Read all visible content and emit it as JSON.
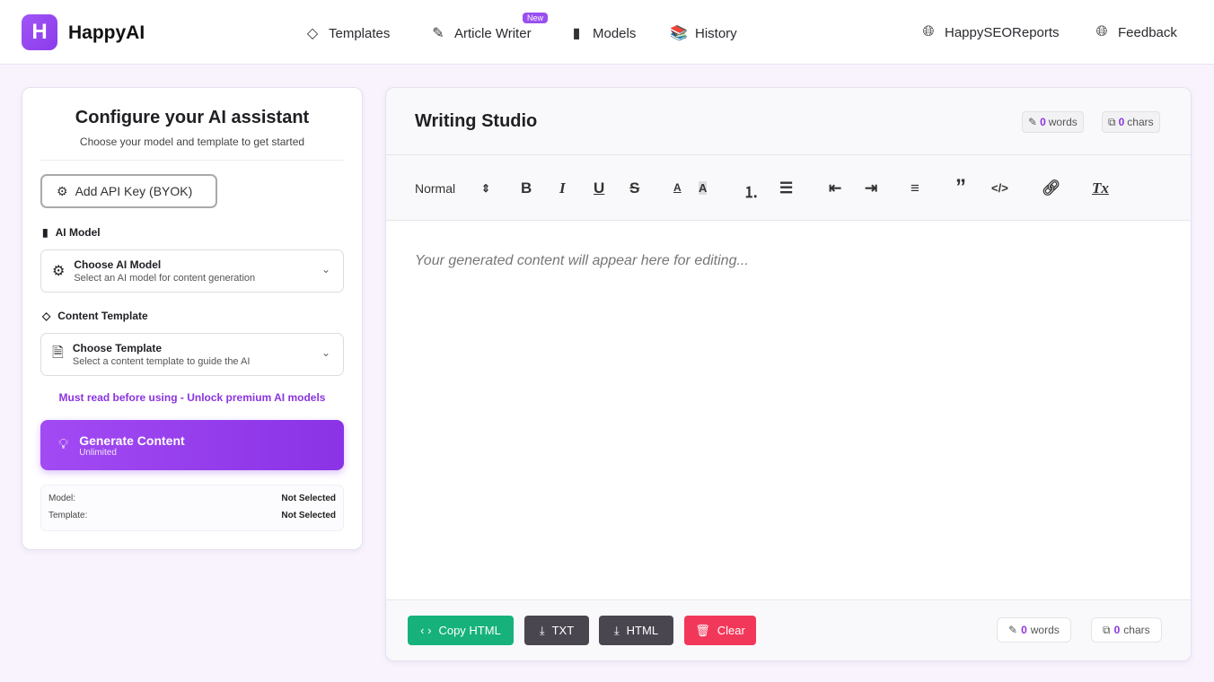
{
  "header": {
    "logo_letter": "H",
    "brand": "HappyAI",
    "nav": [
      {
        "label": "Templates",
        "icon": "tag-icon"
      },
      {
        "label": "Article Writer",
        "icon": "memo-icon",
        "badge": "New"
      },
      {
        "label": "Models",
        "icon": "ruler-icon"
      },
      {
        "label": "History",
        "icon": "books-icon"
      }
    ],
    "right": [
      {
        "label": "HappySEOReports",
        "icon": "globe-icon"
      },
      {
        "label": "Feedback",
        "icon": "globe-icon"
      }
    ]
  },
  "config": {
    "title": "Configure your AI assistant",
    "subtitle": "Choose your model and template to get started",
    "api_button": "Add API Key (BYOK)",
    "model_label": "AI Model",
    "model_select": {
      "title": "Choose AI Model",
      "desc": "Select an AI model for content generation"
    },
    "template_label": "Content Template",
    "template_select": {
      "title": "Choose Template",
      "desc": "Select a content template to guide the AI"
    },
    "notice_link": "Must read before using - Unlock premium AI models",
    "generate": {
      "label": "Generate Content",
      "sub": "Unlimited"
    },
    "summary": [
      {
        "k": "Model:",
        "v": "Not Selected"
      },
      {
        "k": "Template:",
        "v": "Not Selected"
      }
    ]
  },
  "studio": {
    "title": "Writing Studio",
    "words": "0",
    "words_label": "words",
    "chars": "0",
    "chars_label": "chars",
    "format": "Normal",
    "placeholder": "Your generated content will appear here for editing...",
    "buttons": {
      "copy": "Copy HTML",
      "txt": "TXT",
      "html": "HTML",
      "clear": "Clear"
    }
  },
  "colors": {
    "accent": "#8b34e0",
    "copy": "#17b27c",
    "dark": "#4a4650",
    "clear": "#f2385a"
  }
}
